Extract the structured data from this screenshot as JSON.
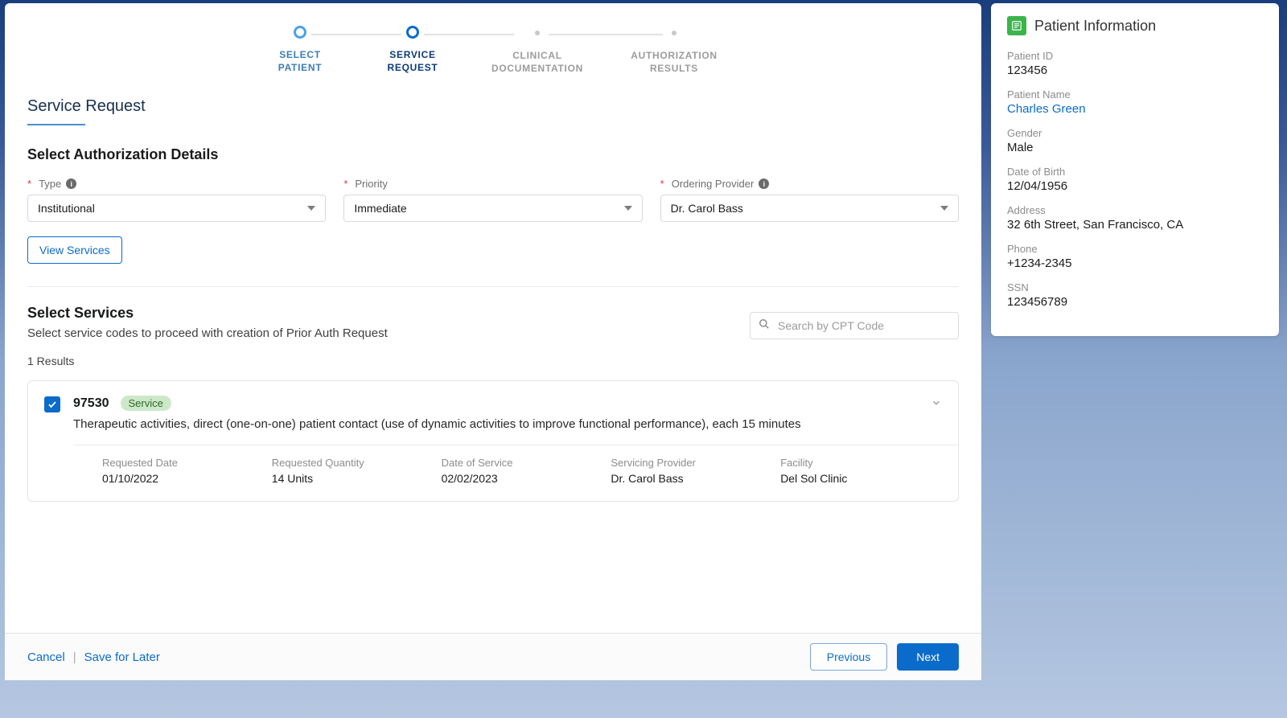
{
  "stepper": [
    {
      "label": "SELECT\nPATIENT",
      "state": "completed"
    },
    {
      "label": "SERVICE\nREQUEST",
      "state": "active"
    },
    {
      "label": "CLINICAL\nDOCUMENTATION",
      "state": "pending"
    },
    {
      "label": "AUTHORIZATION\nRESULTS",
      "state": "pending"
    }
  ],
  "page_title": "Service Request",
  "auth_details": {
    "heading": "Select Authorization Details",
    "type_label": "Type",
    "type_value": "Institutional",
    "priority_label": "Priority",
    "priority_value": "Immediate",
    "provider_label": "Ordering Provider",
    "provider_value": "Dr. Carol Bass",
    "view_services_label": "View Services"
  },
  "services": {
    "heading": "Select Services",
    "subtext": "Select service codes to proceed with creation of Prior Auth Request",
    "search_placeholder": "Search by CPT Code",
    "results_count": "1 Results",
    "items": [
      {
        "checked": true,
        "code": "97530",
        "badge": "Service",
        "description": "Therapeutic activities, direct (one-on-one) patient contact (use of dynamic activities to improve functional performance), each 15 minutes",
        "requested_date_label": "Requested Date",
        "requested_date": "01/10/2022",
        "requested_qty_label": "Requested Quantity",
        "requested_qty": "14 Units",
        "dos_label": "Date of Service",
        "dos": "02/02/2023",
        "servicing_label": "Servicing Provider",
        "servicing": "Dr. Carol Bass",
        "facility_label": "Facility",
        "facility": "Del Sol Clinic"
      }
    ]
  },
  "footer": {
    "cancel": "Cancel",
    "save_later": "Save for Later",
    "previous": "Previous",
    "next": "Next"
  },
  "patient_panel": {
    "title": "Patient Information",
    "id_label": "Patient ID",
    "id_value": "123456",
    "name_label": "Patient Name",
    "name_value": "Charles Green",
    "gender_label": "Gender",
    "gender_value": "Male",
    "dob_label": "Date of Birth",
    "dob_value": "12/04/1956",
    "address_label": "Address",
    "address_value": "32 6th Street, San Francisco, CA",
    "phone_label": "Phone",
    "phone_value": "+1234-2345",
    "ssn_label": "SSN",
    "ssn_value": "123456789"
  }
}
